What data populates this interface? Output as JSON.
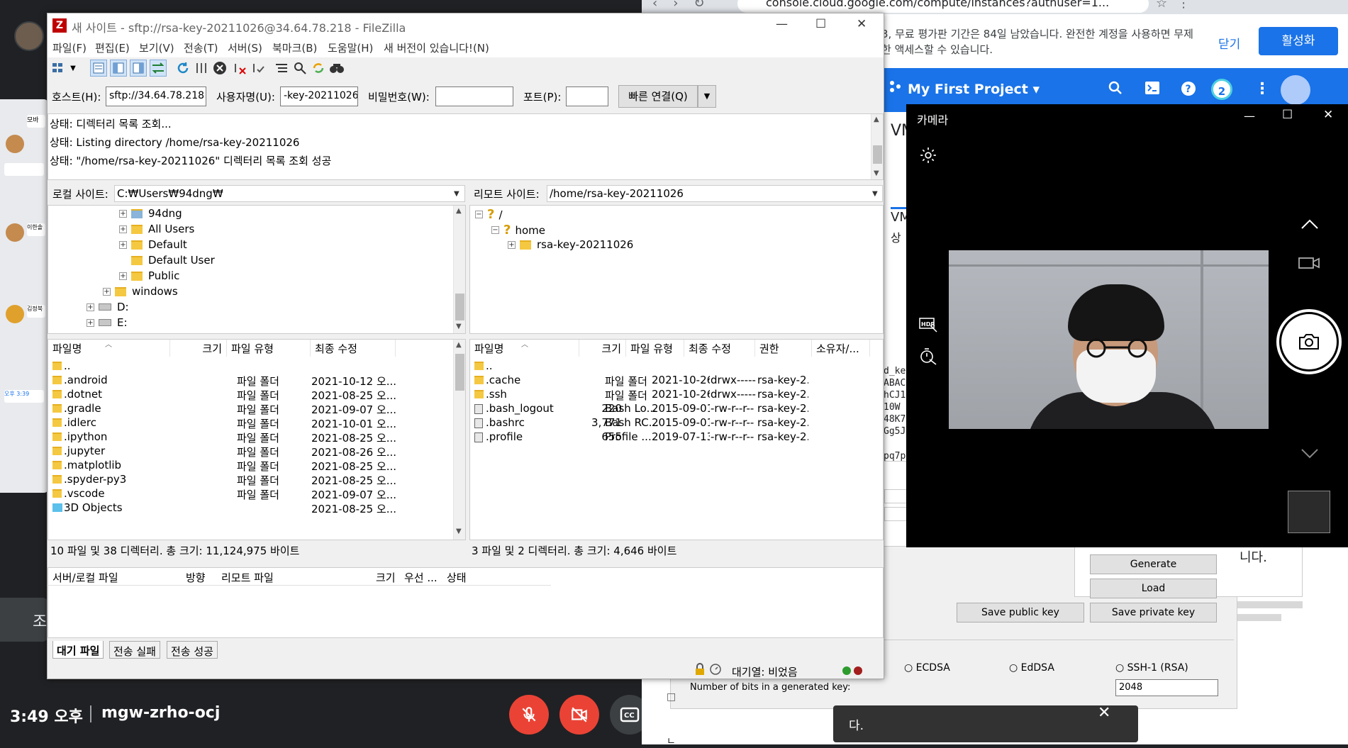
{
  "meet": {
    "time": "3:49 오후",
    "code": "mgw-zrho-ocj",
    "side_button_label": "조",
    "left_tile_texts": [
      "모바",
      "이한솔",
      "김정북",
      "오후 3:39"
    ]
  },
  "chrome": {
    "url": "console.cloud.google.com/compute/instances?authuser=1...",
    "trial_text": "3, 무료 평가판 기간은 84일 남았습니다. 완전한 계정을 사용하면 무제한 액세스할 수 있습니다.",
    "trial_close": "닫기",
    "trial_activate": "활성화",
    "project_name": "My First Project",
    "notification_count": "2",
    "fragment_vm": "VM",
    "fragment_vm2": "VM",
    "fragment_sang": "상",
    "fragment_key_lines": [
      "d_key",
      "ABAC",
      "hCJ1",
      "10W",
      "48K7",
      "Gg5J",
      "pq7pC"
    ]
  },
  "puttygen": {
    "generate": "Generate",
    "load": "Load",
    "save_public": "Save public key",
    "save_private": "Save private key",
    "right_text": "니다.",
    "radio_ecdsa": "ECDSA",
    "radio_eddsa": "EdDSA",
    "radio_ssh1": "SSH-1 (RSA)",
    "bits_label": "Number of bits in a generated key:",
    "bits_value": "2048"
  },
  "toast": {
    "text": "다.",
    "close": "✕"
  },
  "camera": {
    "title": "카메라",
    "min": "—",
    "max": "☐",
    "close": "✕"
  },
  "filezilla": {
    "title": "새 사이트 - sftp://rsa-key-20211026@34.64.78.218 - FileZilla",
    "menu": [
      "파일(F)",
      "편집(E)",
      "보기(V)",
      "전송(T)",
      "서버(S)",
      "북마크(B)",
      "도움말(H)",
      "새 버전이 있습니다!(N)"
    ],
    "quickconnect": {
      "host_label": "호스트(H):",
      "host_value": "sftp://34.64.78.218",
      "user_label": "사용자명(U):",
      "user_value": "-key-20211026",
      "pass_label": "비밀번호(W):",
      "pass_value": "",
      "port_label": "포트(P):",
      "port_value": "",
      "connect_label": "빠른 연결(Q)"
    },
    "log": [
      "상태:  디렉터리 목록 조회...",
      "상태:  Listing directory /home/rsa-key-20211026",
      "상태:  \"/home/rsa-key-20211026\" 디렉터리 목록 조회 성공"
    ],
    "local_site_label": "로컬 사이트:",
    "local_site_path": "C:₩Users₩94dng₩",
    "remote_site_label": "리모트 사이트:",
    "remote_site_path": "/home/rsa-key-20211026",
    "local_tree": [
      {
        "label": "94dng",
        "expander": "+"
      },
      {
        "label": "All Users",
        "expander": "+"
      },
      {
        "label": "Default",
        "expander": "+"
      },
      {
        "label": "Default User",
        "expander": ""
      },
      {
        "label": "Public",
        "expander": "+"
      },
      {
        "label": "windows",
        "expander": "+"
      },
      {
        "label": "D:",
        "expander": "+"
      },
      {
        "label": "E:",
        "expander": "+"
      }
    ],
    "remote_tree": [
      {
        "label": "/",
        "expander": "−"
      },
      {
        "label": "home",
        "expander": "−"
      },
      {
        "label": "rsa-key-20211026",
        "expander": "+"
      }
    ],
    "local_headers": [
      "파일명",
      "크기",
      "파일 유형",
      "최종 수정"
    ],
    "local_files": [
      {
        "name": "..",
        "size": "",
        "type": "",
        "modified": ""
      },
      {
        "name": ".android",
        "size": "",
        "type": "파일 폴더",
        "modified": "2021-10-12 오..."
      },
      {
        "name": ".dotnet",
        "size": "",
        "type": "파일 폴더",
        "modified": "2021-08-25 오..."
      },
      {
        "name": ".gradle",
        "size": "",
        "type": "파일 폴더",
        "modified": "2021-09-07 오..."
      },
      {
        "name": ".idlerc",
        "size": "",
        "type": "파일 폴더",
        "modified": "2021-10-01 오..."
      },
      {
        "name": ".ipython",
        "size": "",
        "type": "파일 폴더",
        "modified": "2021-08-25 오..."
      },
      {
        "name": ".jupyter",
        "size": "",
        "type": "파일 폴더",
        "modified": "2021-08-26 오..."
      },
      {
        "name": ".matplotlib",
        "size": "",
        "type": "파일 폴더",
        "modified": "2021-08-25 오..."
      },
      {
        "name": ".spyder-py3",
        "size": "",
        "type": "파일 폴더",
        "modified": "2021-08-25 오..."
      },
      {
        "name": ".vscode",
        "size": "",
        "type": "파일 폴더",
        "modified": "2021-09-07 오..."
      },
      {
        "name": "3D Objects",
        "size": "",
        "type": "",
        "modified": "2021-08-25 오..."
      }
    ],
    "remote_headers": [
      "파일명",
      "크기",
      "파일 유형",
      "최종 수정",
      "권한",
      "소유자/..."
    ],
    "remote_files": [
      {
        "name": "..",
        "size": "",
        "type": "",
        "modified": "",
        "perm": "",
        "owner": "",
        "kind": "folder"
      },
      {
        "name": ".cache",
        "size": "",
        "type": "파일 폴더",
        "modified": "2021-10-26...",
        "perm": "drwx------",
        "owner": "rsa-key-2...",
        "kind": "folder"
      },
      {
        "name": ".ssh",
        "size": "",
        "type": "파일 폴더",
        "modified": "2021-10-26...",
        "perm": "drwx------",
        "owner": "rsa-key-2...",
        "kind": "folder"
      },
      {
        "name": ".bash_logout",
        "size": "220",
        "type": "Bash Lo...",
        "modified": "2015-09-01...",
        "perm": "-rw-r--r--",
        "owner": "rsa-key-2...",
        "kind": "file"
      },
      {
        "name": ".bashrc",
        "size": "3,771",
        "type": "Bash RC...",
        "modified": "2015-09-01...",
        "perm": "-rw-r--r--",
        "owner": "rsa-key-2...",
        "kind": "file"
      },
      {
        "name": ".profile",
        "size": "655",
        "type": "Profile ...",
        "modified": "2019-07-13...",
        "perm": "-rw-r--r--",
        "owner": "rsa-key-2...",
        "kind": "file"
      }
    ],
    "local_status": "10 파일 및 38 디렉터리. 총 크기: 11,124,975 바이트",
    "remote_status": "3 파일 및 2 디렉터리. 총 크기: 4,646 바이트",
    "queue_headers": [
      "서버/로컬 파일",
      "방향",
      "리모트 파일",
      "크기",
      "우선 ...",
      "상태"
    ],
    "queue_tabs": [
      "대기 파일",
      "전송 실패",
      "전송 성공"
    ],
    "queue_status": "대기열: 비었음"
  }
}
